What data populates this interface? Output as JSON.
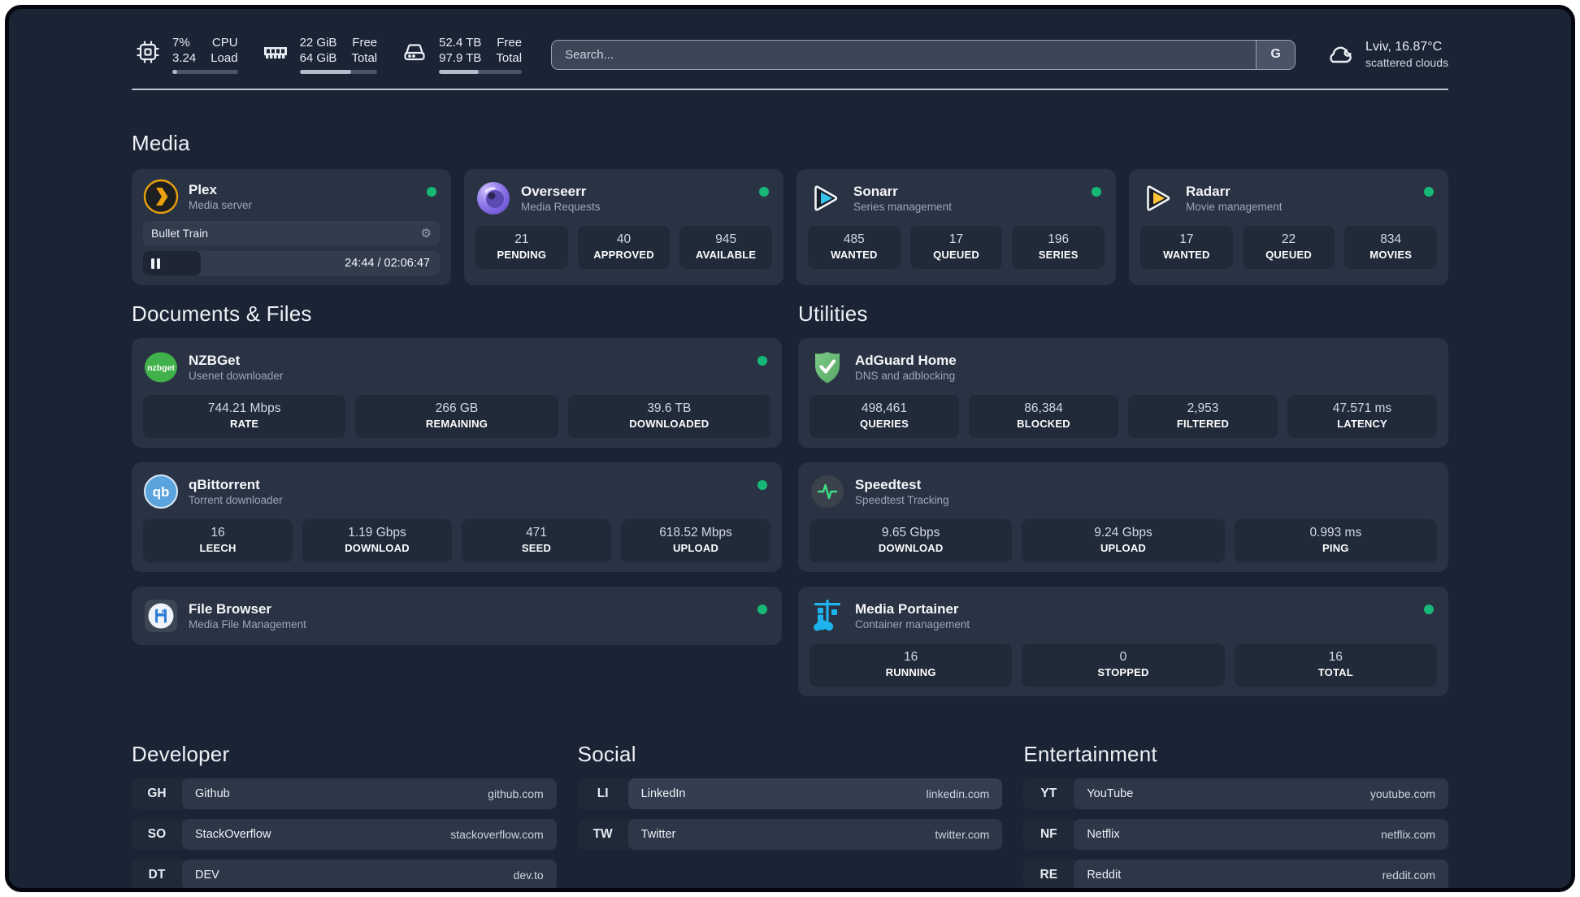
{
  "topbar": {
    "cpu": {
      "value_top": "7%",
      "value_bottom": "3.24",
      "label_top": "CPU",
      "label_bottom": "Load",
      "progress": 7
    },
    "memory": {
      "value_top": "22 GiB",
      "value_bottom": "64 GiB",
      "label_top": "Free",
      "label_bottom": "Total",
      "progress": 66
    },
    "disk": {
      "value_top": "52.4 TB",
      "value_bottom": "97.9 TB",
      "label_top": "Free",
      "label_bottom": "Total",
      "progress": 48
    },
    "search": {
      "placeholder": "Search...",
      "engine": "G"
    },
    "weather": {
      "location": "Lviv, 16.87°C",
      "condition": "scattered clouds"
    }
  },
  "media": {
    "title": "Media",
    "plex": {
      "name": "Plex",
      "subtitle": "Media server",
      "online": true,
      "now_playing": "Bullet Train",
      "time": "24:44 / 02:06:47",
      "progress_pct": 19.5
    },
    "cards": [
      {
        "name": "Overseerr",
        "subtitle": "Media Requests",
        "online": true,
        "stats": [
          {
            "value": "21",
            "label": "PENDING"
          },
          {
            "value": "40",
            "label": "APPROVED"
          },
          {
            "value": "945",
            "label": "AVAILABLE"
          }
        ]
      },
      {
        "name": "Sonarr",
        "subtitle": "Series management",
        "online": true,
        "stats": [
          {
            "value": "485",
            "label": "WANTED"
          },
          {
            "value": "17",
            "label": "QUEUED"
          },
          {
            "value": "196",
            "label": "SERIES"
          }
        ]
      },
      {
        "name": "Radarr",
        "subtitle": "Movie management",
        "online": true,
        "stats": [
          {
            "value": "17",
            "label": "WANTED"
          },
          {
            "value": "22",
            "label": "QUEUED"
          },
          {
            "value": "834",
            "label": "MOVIES"
          }
        ]
      }
    ]
  },
  "documents": {
    "title": "Documents & Files",
    "cards": [
      {
        "name": "NZBGet",
        "subtitle": "Usenet downloader",
        "online": true,
        "stats": [
          {
            "value": "744.21 Mbps",
            "label": "RATE"
          },
          {
            "value": "266 GB",
            "label": "REMAINING"
          },
          {
            "value": "39.6 TB",
            "label": "DOWNLOADED"
          }
        ]
      },
      {
        "name": "qBittorrent",
        "subtitle": "Torrent downloader",
        "online": true,
        "stats": [
          {
            "value": "16",
            "label": "LEECH"
          },
          {
            "value": "1.19 Gbps",
            "label": "DOWNLOAD"
          },
          {
            "value": "471",
            "label": "SEED"
          },
          {
            "value": "618.52 Mbps",
            "label": "UPLOAD"
          }
        ]
      },
      {
        "name": "File Browser",
        "subtitle": "Media File Management",
        "online": true,
        "stats": []
      }
    ]
  },
  "utilities": {
    "title": "Utilities",
    "cards": [
      {
        "name": "AdGuard Home",
        "subtitle": "DNS and adblocking",
        "online": false,
        "stats": [
          {
            "value": "498,461",
            "label": "QUERIES"
          },
          {
            "value": "86,384",
            "label": "BLOCKED"
          },
          {
            "value": "2,953",
            "label": "FILTERED"
          },
          {
            "value": "47.571 ms",
            "label": "LATENCY"
          }
        ]
      },
      {
        "name": "Speedtest",
        "subtitle": "Speedtest Tracking",
        "online": false,
        "stats": [
          {
            "value": "9.65 Gbps",
            "label": "DOWNLOAD"
          },
          {
            "value": "9.24 Gbps",
            "label": "UPLOAD"
          },
          {
            "value": "0.993 ms",
            "label": "PING"
          }
        ]
      },
      {
        "name": "Media Portainer",
        "subtitle": "Container management",
        "online": true,
        "stats": [
          {
            "value": "16",
            "label": "RUNNING"
          },
          {
            "value": "0",
            "label": "STOPPED"
          },
          {
            "value": "16",
            "label": "TOTAL"
          }
        ]
      }
    ]
  },
  "links": {
    "developer": {
      "title": "Developer",
      "items": [
        {
          "abbr": "GH",
          "name": "Github",
          "url": "github.com"
        },
        {
          "abbr": "SO",
          "name": "StackOverflow",
          "url": "stackoverflow.com"
        },
        {
          "abbr": "DT",
          "name": "DEV",
          "url": "dev.to"
        }
      ]
    },
    "social": {
      "title": "Social",
      "items": [
        {
          "abbr": "LI",
          "name": "LinkedIn",
          "url": "linkedin.com"
        },
        {
          "abbr": "TW",
          "name": "Twitter",
          "url": "twitter.com"
        }
      ]
    },
    "entertainment": {
      "title": "Entertainment",
      "items": [
        {
          "abbr": "YT",
          "name": "YouTube",
          "url": "youtube.com"
        },
        {
          "abbr": "NF",
          "name": "Netflix",
          "url": "netflix.com"
        },
        {
          "abbr": "RE",
          "name": "Reddit",
          "url": "reddit.com"
        }
      ]
    }
  },
  "colors": {
    "status_online": "#17b877",
    "plex_accent": "#e5a00d",
    "sonarr_blue": "#38c1ea",
    "radarr_yellow": "#fec53a",
    "adguard_green": "#67b773",
    "portainer_blue": "#1db4ee",
    "nzbget_green": "#41b14b",
    "qbittorrent_blue": "#5aa3dd",
    "speedtest_pulse": "#3ddc84"
  }
}
